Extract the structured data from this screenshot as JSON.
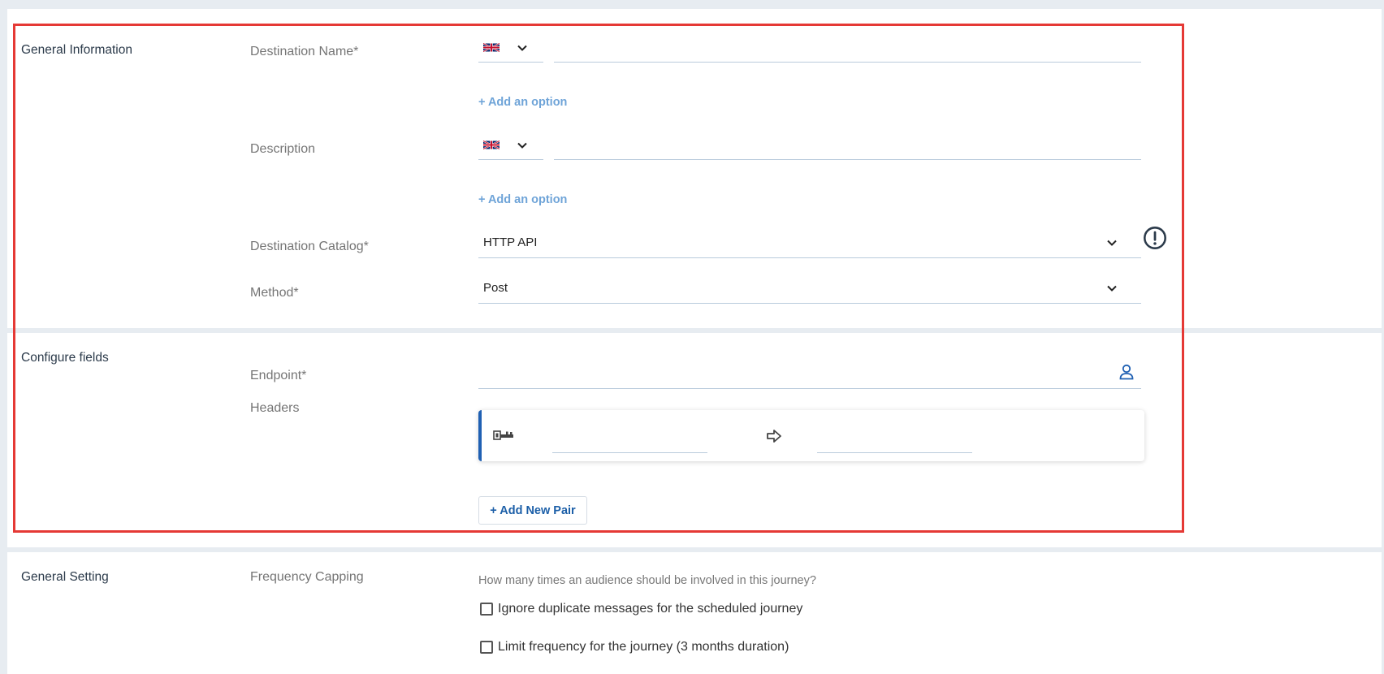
{
  "general_information": {
    "section_title": "General Information",
    "destination_name": {
      "label": "Destination Name*",
      "language_icon": "uk-flag-icon",
      "value": "",
      "add_option": "+ Add an option"
    },
    "description": {
      "label": "Description",
      "language_icon": "uk-flag-icon",
      "value": "",
      "add_option": "+ Add an option"
    },
    "destination_catalog": {
      "label": "Destination Catalog*",
      "selected": "HTTP API",
      "info_icon": "exclamation-circle-icon"
    },
    "method": {
      "label": "Method*",
      "selected": "Post"
    }
  },
  "configure_fields": {
    "section_title": "Configure fields",
    "endpoint": {
      "label": "Endpoint*",
      "value": "",
      "icon": "person-icon"
    },
    "headers": {
      "label": "Headers",
      "pairs": [
        {
          "key_icon": "key-icon",
          "key": "",
          "arrow_icon": "arrow-right-icon",
          "value": ""
        }
      ],
      "add_button": "+ Add New Pair"
    }
  },
  "general_setting": {
    "section_title": "General Setting",
    "frequency_capping": {
      "label": "Frequency Capping",
      "question": "How many times an audience should be involved in this journey?",
      "options": [
        {
          "label": "Ignore duplicate messages for the scheduled journey",
          "checked": false
        },
        {
          "label": "Limit frequency for the journey (3 months duration)",
          "checked": false
        }
      ]
    }
  },
  "colors": {
    "accent": "#1f60b3",
    "link": "#6fa4d8",
    "highlight": "#e53935",
    "background": "#e7ecf1"
  }
}
